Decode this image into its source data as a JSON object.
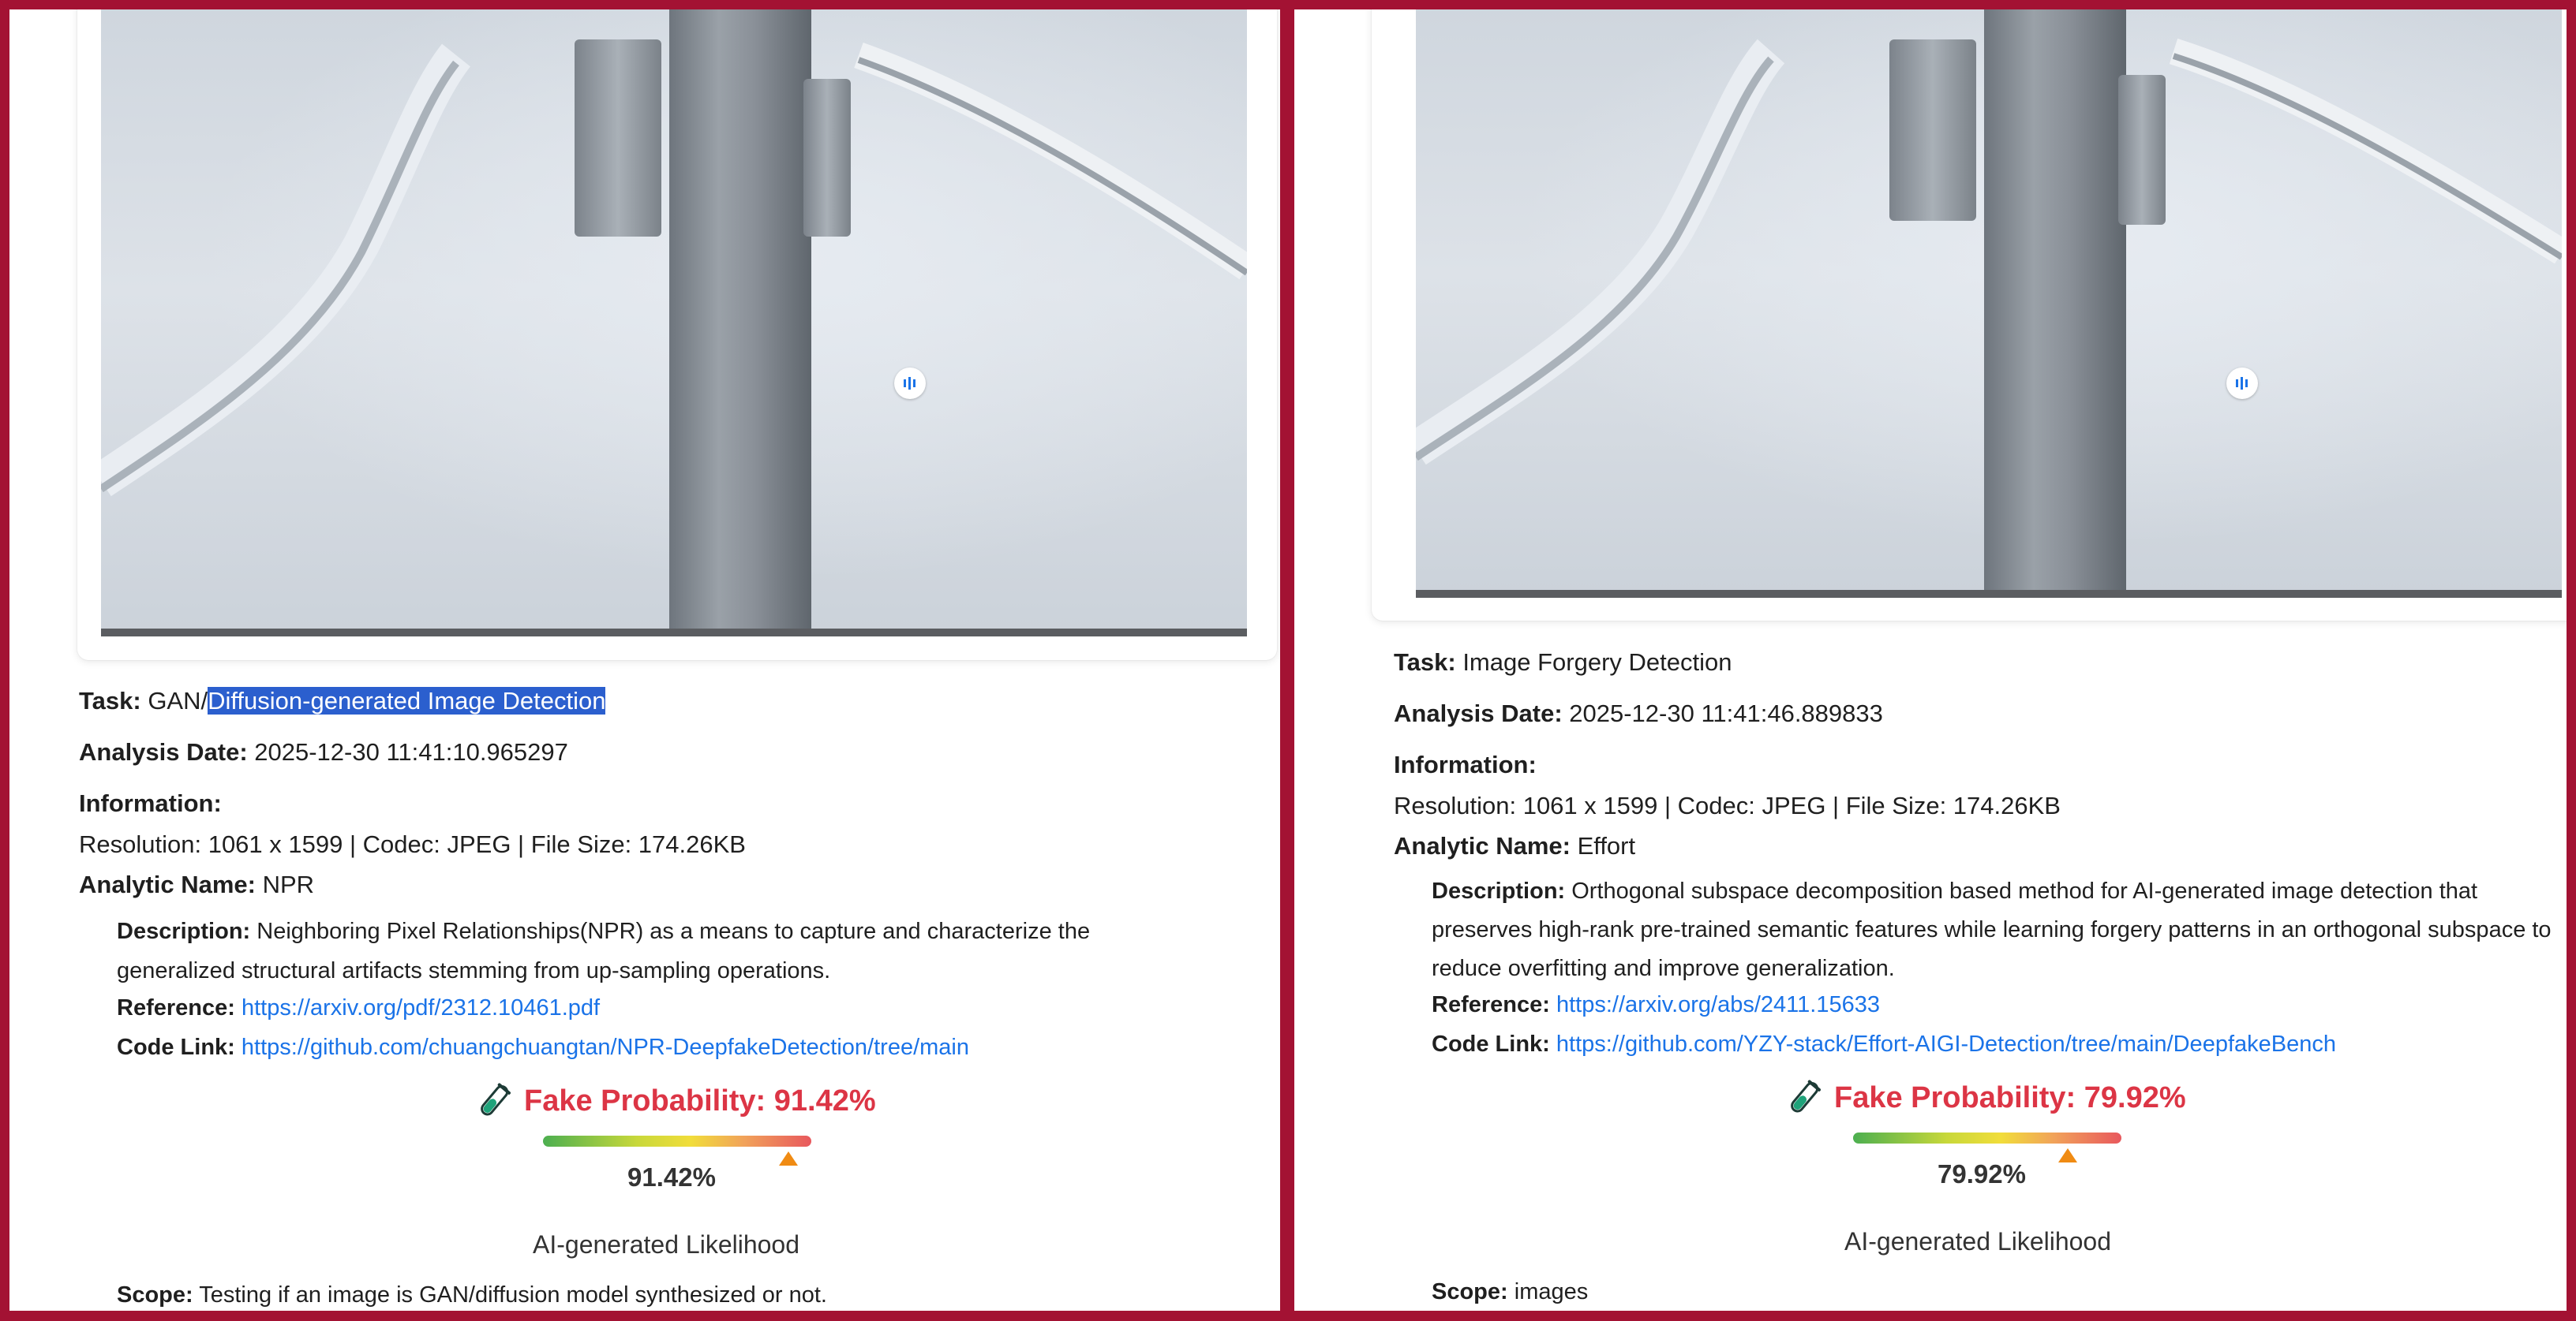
{
  "left": {
    "task_label": "Task:",
    "task_prefix": "GAN/",
    "task_selected": "Diffusion-generated Image Detection",
    "date_label": "Analysis Date:",
    "date_value": "2025-12-30 11:41:10.965297",
    "info_label": "Information:",
    "info_value": "Resolution: 1061 x 1599 | Codec: JPEG | File Size: 174.26KB",
    "analytic_label": "Analytic Name:",
    "analytic_value": "NPR",
    "desc_label": "Description:",
    "desc_value": "Neighboring Pixel Relationships(NPR) as a means to capture and characterize the generalized structural artifacts stemming from up-sampling operations.",
    "ref_label": "Reference:",
    "ref_value": "https://arxiv.org/pdf/2312.10461.pdf",
    "code_label": "Code Link:",
    "code_value": "https://github.com/chuangchuangtan/NPR-DeepfakeDetection/tree/main",
    "fake_prob": "Fake Probability: 91.42%",
    "likelihood_value": 0.9142,
    "pct": "91.42%",
    "likelihood_label": "AI-generated Likelihood",
    "scope_label": "Scope:",
    "scope_value": "Testing if an image is GAN/diffusion model synthesized or not."
  },
  "right": {
    "task_label": "Task:",
    "task_value": "Image Forgery Detection",
    "date_label": "Analysis Date:",
    "date_value": "2025-12-30 11:41:46.889833",
    "info_label": "Information:",
    "info_value": "Resolution: 1061 x 1599 | Codec: JPEG | File Size: 174.26KB",
    "analytic_label": "Analytic Name:",
    "analytic_value": "Effort",
    "desc_label": "Description:",
    "desc_value": "Orthogonal subspace decomposition based method for AI-generated image detection that preserves high-rank pre-trained semantic features while learning forgery patterns in an orthogonal subspace to reduce overfitting and improve generalization.",
    "ref_label": "Reference:",
    "ref_value": "https://arxiv.org/abs/2411.15633",
    "code_label": "Code Link:",
    "code_value": "https://github.com/YZY-stack/Effort-AIGI-Detection/tree/main/DeepfakeBench",
    "fake_prob": "Fake Probability: 79.92%",
    "likelihood_value": 0.7992,
    "pct": "79.92%",
    "likelihood_label": "AI-generated Likelihood",
    "scope_label": "Scope:",
    "scope_value": "images"
  },
  "colors": {
    "frame": "#a31233",
    "fake_red": "#dc3545",
    "link_blue": "#1a73e8",
    "selection": "#2b5fce",
    "marker": "#f08b13"
  },
  "icons": {
    "test_tube": "test-tube-icon",
    "play": "play-icon"
  }
}
